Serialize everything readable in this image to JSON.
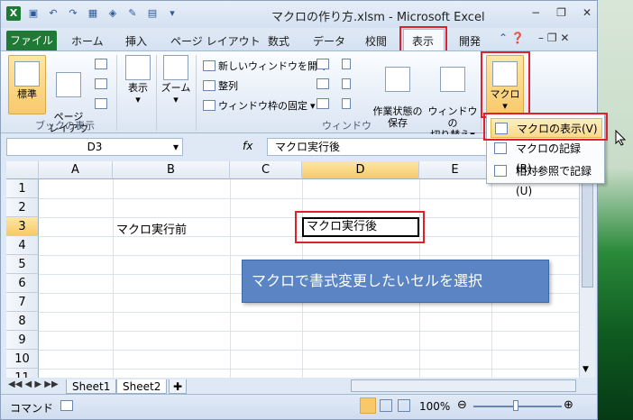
{
  "window": {
    "title": "マクロの作り方.xlsm - Microsoft Excel",
    "app_icon": "X",
    "minimize": "−",
    "restore": "❐",
    "close": "✕"
  },
  "tabs": [
    "ホーム",
    "挿入",
    "ページ レイアウト",
    "数式",
    "データ",
    "校閲",
    "表示",
    "開発"
  ],
  "file_tab": "ファイル",
  "ribbon": {
    "book_view": {
      "label": "ブックの表示",
      "normal": "標準",
      "page_layout": "ページ\nレイアウト"
    },
    "show": {
      "label": "表示"
    },
    "zoom": {
      "label": "ズーム"
    },
    "window": {
      "label": "ウィンドウ",
      "new_window": "新しいウィンドウを開く",
      "arrange": "整列",
      "freeze": "ウィンドウ枠の固定",
      "save_ws": "作業状態の\n保存",
      "switch": "ウィンドウの\n切り替え"
    },
    "macro": {
      "label": "マクロ"
    }
  },
  "formula_bar": {
    "name_box": "D3",
    "fx": "fx",
    "formula": "マクロ実行後"
  },
  "columns": [
    "A",
    "B",
    "C",
    "D",
    "E"
  ],
  "rows": [
    "1",
    "2",
    "3",
    "4",
    "5",
    "6",
    "7",
    "8",
    "9",
    "10",
    "11"
  ],
  "cells": {
    "B3": "マクロ実行前",
    "D3": "マクロ実行後"
  },
  "sheets": [
    "Sheet1",
    "Sheet2"
  ],
  "status": {
    "mode": "コマンド",
    "zoom": "100%"
  },
  "macro_menu": {
    "view": "マクロの表示(V)",
    "record": "マクロの記録(R)...",
    "relative": "相対参照で記録(U)"
  },
  "callout": "マクロで書式変更したいセルを選択",
  "colors": {
    "accent": "#e0202a",
    "file_tab": "#1e7a35",
    "callout": "#5a84c3"
  }
}
